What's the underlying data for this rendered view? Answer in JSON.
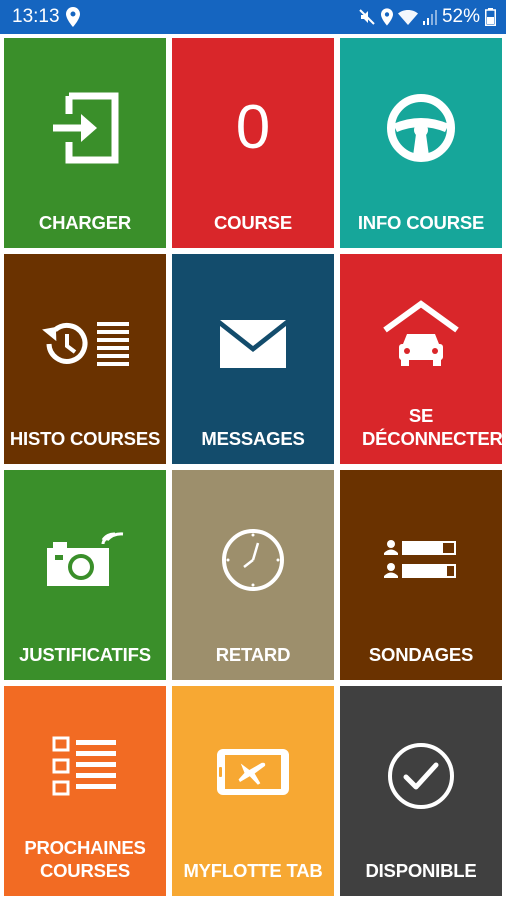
{
  "status_bar": {
    "time": "13:13",
    "battery": "52%",
    "background": "#1565c0"
  },
  "tiles": [
    {
      "label": "CHARGER",
      "color": "#3a8f2a",
      "icon": "login-icon"
    },
    {
      "label": "COURSE",
      "color": "#d9262a",
      "value": "0"
    },
    {
      "label": "INFO COURSE",
      "color": "#16a69a",
      "icon": "steering-wheel-icon"
    },
    {
      "label": "HISTO COURSES",
      "color": "#6a3200",
      "icon": "history-list-icon"
    },
    {
      "label": "MESSAGES",
      "color": "#134c6c",
      "icon": "envelope-icon"
    },
    {
      "label": "SE DÉCONNECTER",
      "color": "#d9262a",
      "icon": "garage-car-icon"
    },
    {
      "label": "JUSTIFICATIFS",
      "color": "#3a8f2a",
      "icon": "wireless-camera-icon"
    },
    {
      "label": "RETARD",
      "color": "#9d8f6c",
      "icon": "clock-icon"
    },
    {
      "label": "SONDAGES",
      "color": "#6a3200",
      "icon": "poll-icon"
    },
    {
      "label": "PROCHAINES COURSES",
      "color": "#f26b23",
      "icon": "checklist-icon"
    },
    {
      "label": "MYFLOTTE TAB",
      "color": "#f7a833",
      "icon": "tablet-plane-icon"
    },
    {
      "label": "DISPONIBLE",
      "color": "#404040",
      "icon": "check-circle-icon"
    }
  ]
}
